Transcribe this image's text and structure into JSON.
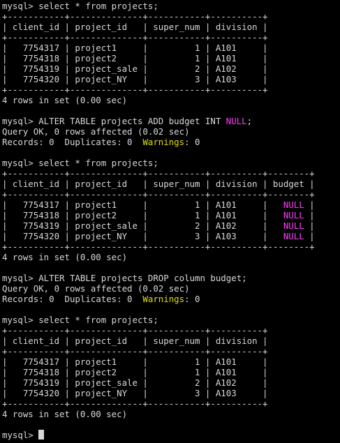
{
  "terminal": {
    "lines": [
      [
        {
          "t": "mysql> select * from projects;"
        }
      ],
      [
        {
          "t": "+-----------+--------------+-----------+----------+"
        }
      ],
      [
        {
          "t": "| client_id | project_id   | super_num | division |"
        }
      ],
      [
        {
          "t": "+-----------+--------------+-----------+----------+"
        }
      ],
      [
        {
          "t": "|   7754317 | project1     |         1 | A101     |"
        }
      ],
      [
        {
          "t": "|   7754318 | project2     |         1 | A101     |"
        }
      ],
      [
        {
          "t": "|   7754319 | project_sale |         2 | A102     |"
        }
      ],
      [
        {
          "t": "|   7754320 | project_NY   |         3 | A103     |"
        }
      ],
      [
        {
          "t": "+-----------+--------------+-----------+----------+"
        }
      ],
      [
        {
          "t": "4 rows in set (0.00 sec)"
        }
      ],
      [
        {
          "t": ""
        }
      ],
      [
        {
          "t": "mysql> ALTER TABLE projects ADD budget INT "
        },
        {
          "t": "NULL",
          "c": "null"
        },
        {
          "t": ";"
        }
      ],
      [
        {
          "t": "Query OK, 0 rows affected (0.02 sec)"
        }
      ],
      [
        {
          "t": "Records: 0  Duplicates: 0  "
        },
        {
          "t": "Warnings",
          "c": "warn"
        },
        {
          "t": ": 0"
        }
      ],
      [
        {
          "t": ""
        }
      ],
      [
        {
          "t": "mysql> select * from projects;"
        }
      ],
      [
        {
          "t": "+-----------+--------------+-----------+----------+--------+"
        }
      ],
      [
        {
          "t": "| client_id | project_id   | super_num | division | budget |"
        }
      ],
      [
        {
          "t": "+-----------+--------------+-----------+----------+--------+"
        }
      ],
      [
        {
          "t": "|   7754317 | project1     |         1 | A101     |   "
        },
        {
          "t": "NULL",
          "c": "null"
        },
        {
          "t": " |"
        }
      ],
      [
        {
          "t": "|   7754318 | project2     |         1 | A101     |   "
        },
        {
          "t": "NULL",
          "c": "null"
        },
        {
          "t": " |"
        }
      ],
      [
        {
          "t": "|   7754319 | project_sale |         2 | A102     |   "
        },
        {
          "t": "NULL",
          "c": "null"
        },
        {
          "t": " |"
        }
      ],
      [
        {
          "t": "|   7754320 | project_NY   |         3 | A103     |   "
        },
        {
          "t": "NULL",
          "c": "null"
        },
        {
          "t": " |"
        }
      ],
      [
        {
          "t": "+-----------+--------------+-----------+----------+--------+"
        }
      ],
      [
        {
          "t": "4 rows in set (0.00 sec)"
        }
      ],
      [
        {
          "t": ""
        }
      ],
      [
        {
          "t": "mysql> ALTER TABLE projects DROP column budget;"
        }
      ],
      [
        {
          "t": "Query OK, 0 rows affected (0.02 sec)"
        }
      ],
      [
        {
          "t": "Records: 0  Duplicates: 0  "
        },
        {
          "t": "Warnings",
          "c": "warn"
        },
        {
          "t": ": 0"
        }
      ],
      [
        {
          "t": ""
        }
      ],
      [
        {
          "t": "mysql> select * from projects;"
        }
      ],
      [
        {
          "t": "+-----------+--------------+-----------+----------+"
        }
      ],
      [
        {
          "t": "| client_id | project_id   | super_num | division |"
        }
      ],
      [
        {
          "t": "+-----------+--------------+-----------+----------+"
        }
      ],
      [
        {
          "t": "|   7754317 | project1     |         1 | A101     |"
        }
      ],
      [
        {
          "t": "|   7754318 | project2     |         1 | A101     |"
        }
      ],
      [
        {
          "t": "|   7754319 | project_sale |         2 | A102     |"
        }
      ],
      [
        {
          "t": "|   7754320 | project_NY   |         3 | A103     |"
        }
      ],
      [
        {
          "t": "+-----------+--------------+-----------+----------+"
        }
      ],
      [
        {
          "t": "4 rows in set (0.00 sec)"
        }
      ],
      [
        {
          "t": ""
        }
      ],
      [
        {
          "t": "mysql> "
        }
      ]
    ],
    "colors": {
      "background": "#000000",
      "text": "#d9d9d9",
      "null_keyword": "#ff3dff",
      "warnings_label": "#e0e000",
      "cursor": "#d9d9d9"
    }
  }
}
